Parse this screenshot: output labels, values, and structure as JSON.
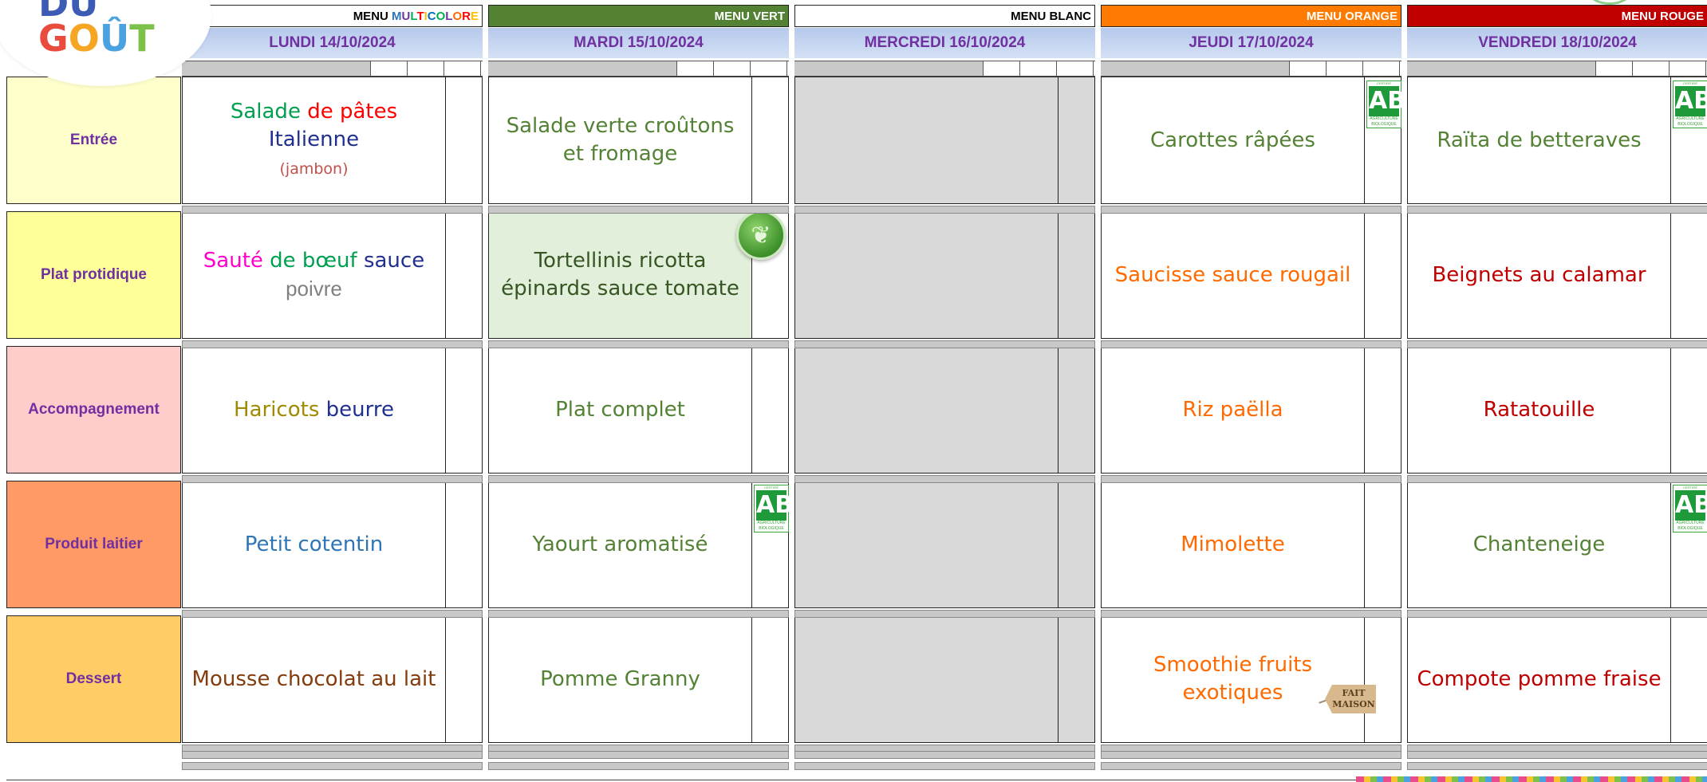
{
  "logo": {
    "line1": "DU",
    "line2_letters": [
      "G",
      "O",
      "Û",
      "T"
    ],
    "line2_colors": [
      "#e94c3d",
      "#f5a623",
      "#4aa2e0",
      "#7cc14a"
    ],
    "line1_color": "#3b5bb5"
  },
  "categories": [
    {
      "label": "Entrée",
      "color": "#ffffcc"
    },
    {
      "label": "Plat protidique",
      "color": "#ffff99"
    },
    {
      "label": "Accompagnement",
      "color": "#ffcccc"
    },
    {
      "label": "Produit laitier",
      "color": "#ff9966"
    },
    {
      "label": "Dessert",
      "color": "#ffcc66"
    }
  ],
  "days": [
    {
      "menu_label_parts": [
        {
          "text": "MENU ",
          "color": "#000000"
        },
        {
          "text": "M",
          "color": "#2e75b6"
        },
        {
          "text": "U",
          "color": "#7030a0"
        },
        {
          "text": "L",
          "color": "#00b050"
        },
        {
          "text": "T",
          "color": "#ff0000"
        },
        {
          "text": "I",
          "color": "#ffc000"
        },
        {
          "text": "C",
          "color": "#0070c0"
        },
        {
          "text": "O",
          "color": "#00b050"
        },
        {
          "text": "L",
          "color": "#7030a0"
        },
        {
          "text": "O",
          "color": "#ff6600"
        },
        {
          "text": "R",
          "color": "#ff0000"
        },
        {
          "text": "E",
          "color": "#ffc000"
        }
      ],
      "menu_bg": "#ffffff",
      "date": "LUNDI  14/10/2024",
      "dishes": [
        {
          "parts": [
            {
              "text": "Salade ",
              "color": "#00a050"
            },
            {
              "text": "de pâtes ",
              "color": "#ff0000"
            },
            {
              "text": "Italienne",
              "color": "#203090"
            }
          ],
          "sub": "(jambon)",
          "sub_color": "#c0504d",
          "bg": "#ffffff"
        },
        {
          "parts": [
            {
              "text": "Sauté ",
              "color": "#ff00cc"
            },
            {
              "text": "de bœuf ",
              "color": "#00a050"
            },
            {
              "text": "sauce",
              "color": "#203090"
            }
          ],
          "sub": "poivre",
          "sub_color": "#808080",
          "sub_big": true,
          "bg": "#ffffff"
        },
        {
          "parts": [
            {
              "text": "Haricots ",
              "color": "#a08a00"
            },
            {
              "text": "beurre",
              "color": "#203090"
            }
          ],
          "bg": "#ffffff"
        },
        {
          "parts": [
            {
              "text": "Petit cotentin",
              "color": "#2e75b6"
            }
          ],
          "bg": "#ffffff"
        },
        {
          "parts": [
            {
              "text": "Mousse chocolat au lait",
              "color": "#843c0c"
            }
          ],
          "bg": "#ffffff"
        }
      ]
    },
    {
      "menu_label_parts": [
        {
          "text": "MENU VERT",
          "color": "#ffffff"
        }
      ],
      "menu_bg": "#548235",
      "date": "MARDI 15/10/2024",
      "dishes": [
        {
          "parts": [
            {
              "text": "Salade verte croûtons et fromage",
              "color": "#548235"
            }
          ],
          "bg": "#ffffff"
        },
        {
          "parts": [
            {
              "text": "Tortellinis ricotta épinards sauce tomate",
              "color": "#375623"
            }
          ],
          "bg": "#e2efda",
          "veg_badge": true
        },
        {
          "parts": [
            {
              "text": "Plat complet",
              "color": "#548235"
            }
          ],
          "bg": "#ffffff"
        },
        {
          "parts": [
            {
              "text": "Yaourt aromatisé",
              "color": "#548235"
            }
          ],
          "bg": "#ffffff",
          "ab": true
        },
        {
          "parts": [
            {
              "text": "Pomme Granny",
              "color": "#548235"
            }
          ],
          "bg": "#ffffff"
        }
      ]
    },
    {
      "menu_label_parts": [
        {
          "text": "MENU BLANC",
          "color": "#000000"
        }
      ],
      "menu_bg": "#ffffff",
      "date": "MERCREDI 16/10/2024",
      "dishes": [
        {
          "parts": [],
          "bg": "#d9d9d9"
        },
        {
          "parts": [],
          "bg": "#d9d9d9"
        },
        {
          "parts": [],
          "bg": "#d9d9d9"
        },
        {
          "parts": [],
          "bg": "#d9d9d9"
        },
        {
          "parts": [],
          "bg": "#d9d9d9"
        }
      ]
    },
    {
      "menu_label_parts": [
        {
          "text": "MENU ORANGE",
          "color": "#ffffff"
        }
      ],
      "menu_bg": "#ff7a00",
      "date": "JEUDI 17/10/2024",
      "dishes": [
        {
          "parts": [
            {
              "text": "Carottes râpées",
              "color": "#548235"
            }
          ],
          "bg": "#ffffff",
          "ab": true
        },
        {
          "parts": [
            {
              "text": "Saucisse sauce rougail",
              "color": "#ff6a00"
            }
          ],
          "bg": "#ffffff"
        },
        {
          "parts": [
            {
              "text": "Riz paëlla",
              "color": "#ff6a00"
            }
          ],
          "bg": "#ffffff"
        },
        {
          "parts": [
            {
              "text": "Mimolette",
              "color": "#ff6a00"
            }
          ],
          "bg": "#ffffff"
        },
        {
          "parts": [
            {
              "text": "Smoothie fruits exotiques",
              "color": "#ff6a00"
            }
          ],
          "bg": "#ffffff",
          "tag": true
        }
      ]
    },
    {
      "menu_label_parts": [
        {
          "text": "MENU ROUGE",
          "color": "#ffffff"
        }
      ],
      "menu_bg": "#c00000",
      "date": "VENDREDI 18/10/2024",
      "dishes": [
        {
          "parts": [
            {
              "text": "Raïta de betteraves",
              "color": "#548235"
            }
          ],
          "bg": "#ffffff",
          "ab": true
        },
        {
          "parts": [
            {
              "text": "Beignets au calamar",
              "color": "#c00000"
            }
          ],
          "bg": "#ffffff"
        },
        {
          "parts": [
            {
              "text": "Ratatouille",
              "color": "#c00000"
            }
          ],
          "bg": "#ffffff"
        },
        {
          "parts": [
            {
              "text": "Chanteneige",
              "color": "#548235"
            }
          ],
          "bg": "#ffffff",
          "ab": true
        },
        {
          "parts": [
            {
              "text": "Compote pomme fraise",
              "color": "#c00000"
            }
          ],
          "bg": "#ffffff"
        }
      ]
    }
  ],
  "ab_label": {
    "big": "AB",
    "top": "CERTIFIÉ",
    "bottom": "AGRICULTURE BIOLOGIQUE"
  },
  "tag_label": {
    "line1": "FAIT",
    "line2": "MAISON"
  },
  "veg_icon": "leaf-icon"
}
